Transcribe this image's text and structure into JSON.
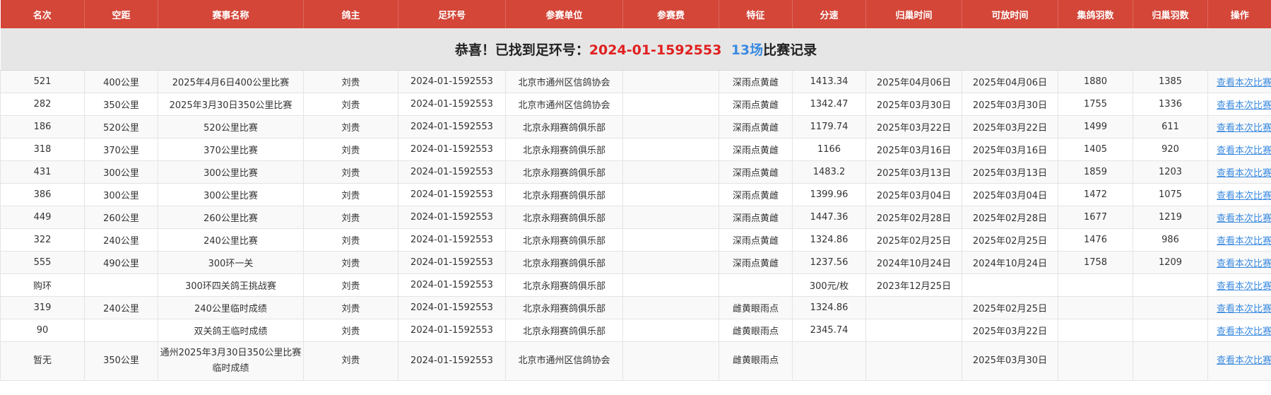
{
  "columns": [
    "名次",
    "空距",
    "赛事名称",
    "鸽主",
    "足环号",
    "参赛单位",
    "参赛费",
    "特征",
    "分速",
    "归巢时间",
    "可放时间",
    "集鸽羽数",
    "归巢羽数",
    "操作"
  ],
  "banner": {
    "prefix": "恭喜！已找到足环号：",
    "ring": "2024-01-1592553",
    "count": "13场",
    "suffix": "比赛记录"
  },
  "link_label": "查看本次比赛",
  "rows": [
    {
      "rank": "521",
      "distance": "400公里",
      "race": "2025年4月6日400公里比赛",
      "owner": "刘贵",
      "ring": "2024-01-1592553",
      "unit": "北京市通州区信鸽协会",
      "fee": "",
      "feature": "深雨点黄雌",
      "speed": "1413.34",
      "return_time": "2025年04月06日",
      "release_time": "2025年04月06日",
      "collected": "1880",
      "returned": "1385"
    },
    {
      "rank": "282",
      "distance": "350公里",
      "race": "2025年3月30日350公里比赛",
      "owner": "刘贵",
      "ring": "2024-01-1592553",
      "unit": "北京市通州区信鸽协会",
      "fee": "",
      "feature": "深雨点黄雌",
      "speed": "1342.47",
      "return_time": "2025年03月30日",
      "release_time": "2025年03月30日",
      "collected": "1755",
      "returned": "1336"
    },
    {
      "rank": "186",
      "distance": "520公里",
      "race": "520公里比赛",
      "owner": "刘贵",
      "ring": "2024-01-1592553",
      "unit": "北京永翔赛鸽俱乐部",
      "fee": "",
      "feature": "深雨点黄雌",
      "speed": "1179.74",
      "return_time": "2025年03月22日",
      "release_time": "2025年03月22日",
      "collected": "1499",
      "returned": "611"
    },
    {
      "rank": "318",
      "distance": "370公里",
      "race": "370公里比赛",
      "owner": "刘贵",
      "ring": "2024-01-1592553",
      "unit": "北京永翔赛鸽俱乐部",
      "fee": "",
      "feature": "深雨点黄雌",
      "speed": "1166",
      "return_time": "2025年03月16日",
      "release_time": "2025年03月16日",
      "collected": "1405",
      "returned": "920"
    },
    {
      "rank": "431",
      "distance": "300公里",
      "race": "300公里比赛",
      "owner": "刘贵",
      "ring": "2024-01-1592553",
      "unit": "北京永翔赛鸽俱乐部",
      "fee": "",
      "feature": "深雨点黄雌",
      "speed": "1483.2",
      "return_time": "2025年03月13日",
      "release_time": "2025年03月13日",
      "collected": "1859",
      "returned": "1203"
    },
    {
      "rank": "386",
      "distance": "300公里",
      "race": "300公里比赛",
      "owner": "刘贵",
      "ring": "2024-01-1592553",
      "unit": "北京永翔赛鸽俱乐部",
      "fee": "",
      "feature": "深雨点黄雌",
      "speed": "1399.96",
      "return_time": "2025年03月04日",
      "release_time": "2025年03月04日",
      "collected": "1472",
      "returned": "1075"
    },
    {
      "rank": "449",
      "distance": "260公里",
      "race": "260公里比赛",
      "owner": "刘贵",
      "ring": "2024-01-1592553",
      "unit": "北京永翔赛鸽俱乐部",
      "fee": "",
      "feature": "深雨点黄雌",
      "speed": "1447.36",
      "return_time": "2025年02月28日",
      "release_time": "2025年02月28日",
      "collected": "1677",
      "returned": "1219"
    },
    {
      "rank": "322",
      "distance": "240公里",
      "race": "240公里比赛",
      "owner": "刘贵",
      "ring": "2024-01-1592553",
      "unit": "北京永翔赛鸽俱乐部",
      "fee": "",
      "feature": "深雨点黄雌",
      "speed": "1324.86",
      "return_time": "2025年02月25日",
      "release_time": "2025年02月25日",
      "collected": "1476",
      "returned": "986"
    },
    {
      "rank": "555",
      "distance": "490公里",
      "race": "300环一关",
      "owner": "刘贵",
      "ring": "2024-01-1592553",
      "unit": "北京永翔赛鸽俱乐部",
      "fee": "",
      "feature": "深雨点黄雌",
      "speed": "1237.56",
      "return_time": "2024年10月24日",
      "release_time": "2024年10月24日",
      "collected": "1758",
      "returned": "1209"
    },
    {
      "rank": "购环",
      "distance": "",
      "race": "300环四关鸽王挑战赛",
      "owner": "刘贵",
      "ring": "2024-01-1592553",
      "unit": "北京永翔赛鸽俱乐部",
      "fee": "",
      "feature": "",
      "speed": "300元/枚",
      "return_time": "2023年12月25日",
      "release_time": "",
      "collected": "",
      "returned": ""
    },
    {
      "rank": "319",
      "distance": "240公里",
      "race": "240公里临时成绩",
      "owner": "刘贵",
      "ring": "2024-01-1592553",
      "unit": "北京永翔赛鸽俱乐部",
      "fee": "",
      "feature": "雌黄眼雨点",
      "speed": "1324.86",
      "return_time": "",
      "release_time": "2025年02月25日",
      "collected": "",
      "returned": ""
    },
    {
      "rank": "90",
      "distance": "",
      "race": "双关鸽王临时成绩",
      "owner": "刘贵",
      "ring": "2024-01-1592553",
      "unit": "北京永翔赛鸽俱乐部",
      "fee": "",
      "feature": "雌黄眼雨点",
      "speed": "2345.74",
      "return_time": "",
      "release_time": "2025年03月22日",
      "collected": "",
      "returned": ""
    },
    {
      "rank": "暂无",
      "distance": "350公里",
      "race": "通州2025年3月30日350公里比赛临时成绩",
      "owner": "刘贵",
      "ring": "2024-01-1592553",
      "unit": "北京市通州区信鸽协会",
      "fee": "",
      "feature": "雌黄眼雨点",
      "speed": "",
      "return_time": "",
      "release_time": "2025年03月30日",
      "collected": "",
      "returned": ""
    }
  ]
}
